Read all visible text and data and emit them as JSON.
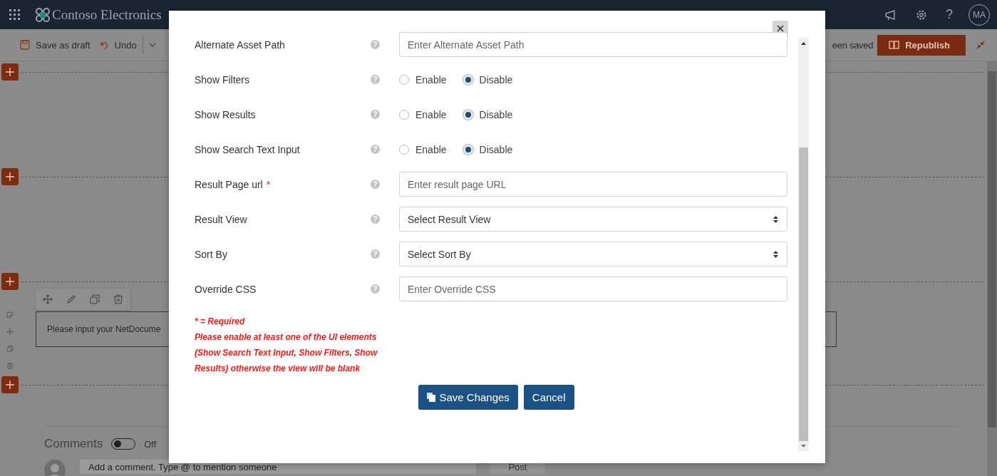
{
  "suite_bar": {
    "site_title": "Contoso Electronics",
    "help": "?",
    "avatar_initials": "MA"
  },
  "command_bar": {
    "save_draft": "Save as draft",
    "undo": "Undo",
    "status": "een saved",
    "republish": "Republish"
  },
  "canvas": {
    "webpart_text": "Please input your NetDocume"
  },
  "comments": {
    "label": "Comments",
    "toggle": {
      "on": false
    },
    "toggle_label": "Off",
    "input_placeholder": "Add a comment. Type @ to mention someone",
    "post": "Post"
  },
  "dialog": {
    "fields": [
      {
        "kind": "text",
        "label": "Alternate Asset Path",
        "help": "?",
        "placeholder": "Enter Alternate Asset Path"
      },
      {
        "kind": "radio",
        "label": "Show Filters",
        "help": "?",
        "options": [
          {
            "label": "Enable",
            "selected": false
          },
          {
            "label": "Disable",
            "selected": true
          }
        ]
      },
      {
        "kind": "radio",
        "label": "Show Results",
        "help": "?",
        "options": [
          {
            "label": "Enable",
            "selected": false
          },
          {
            "label": "Disable",
            "selected": true
          }
        ]
      },
      {
        "kind": "radio",
        "label": "Show Search Text Input",
        "help": "?",
        "options": [
          {
            "label": "Enable",
            "selected": false
          },
          {
            "label": "Disable",
            "selected": true
          }
        ]
      },
      {
        "kind": "text",
        "label": "Result Page url",
        "required_mark": "*",
        "help": "?",
        "placeholder": "Enter result page URL"
      },
      {
        "kind": "select",
        "label": "Result View",
        "help": "?",
        "value": "Select Result View"
      },
      {
        "kind": "select",
        "label": "Sort By",
        "help": "?",
        "value": "Select Sort By"
      },
      {
        "kind": "text",
        "label": "Override CSS",
        "help": "?",
        "placeholder": "Enter Override CSS"
      }
    ],
    "notes": [
      "* = Required",
      "Please enable at least one of the UI elements (Show Search Text Input, Show Filters, Show Results) otherwise the view will be blank"
    ],
    "buttons": [
      {
        "kind": "save",
        "label": "Save Changes"
      },
      {
        "kind": "cancel",
        "label": "Cancel"
      }
    ]
  }
}
